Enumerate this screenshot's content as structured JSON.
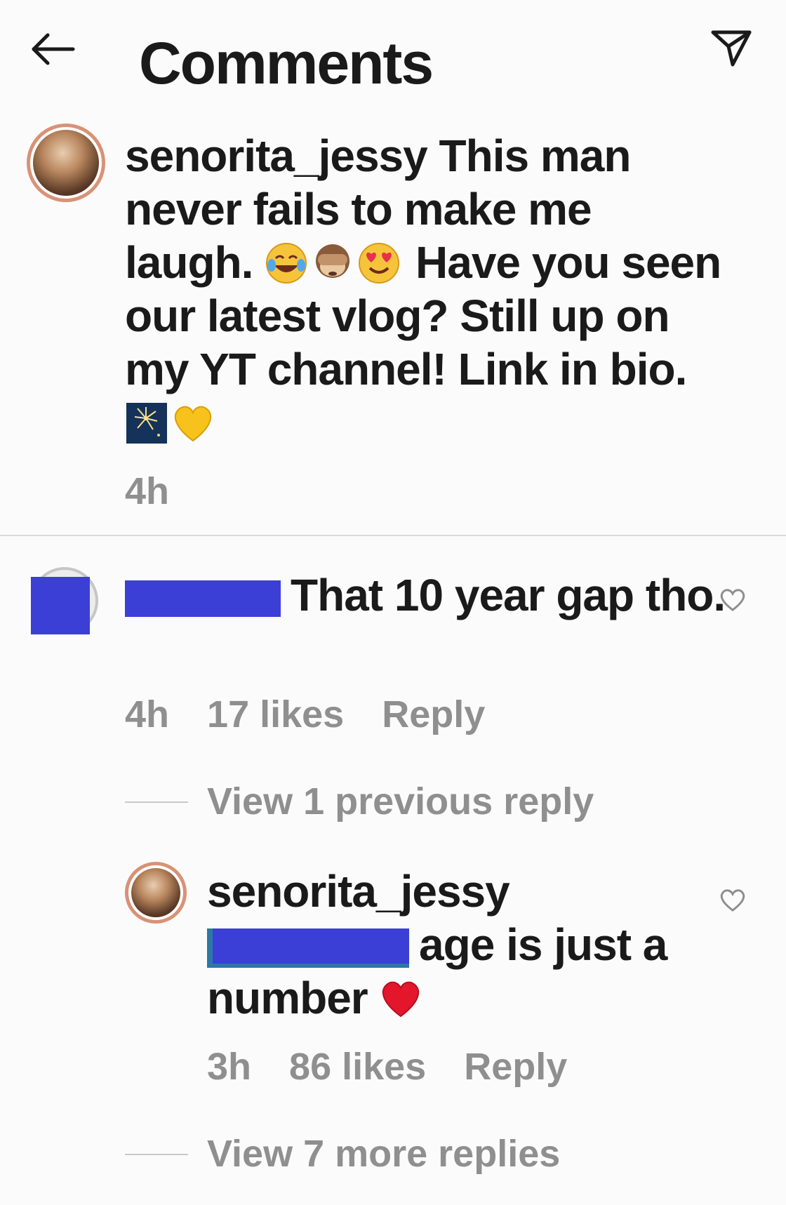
{
  "header": {
    "title": "Comments",
    "back_icon": "arrow-left-icon",
    "share_icon": "paper-plane-icon"
  },
  "caption": {
    "username": "senorita_jessy",
    "text_part1": "This man never fails to make me laugh.",
    "emojis_1": [
      "tears-of-joy",
      "see-no-evil-monkey",
      "heart-eyes"
    ],
    "text_part2": "Have you seen our latest vlog? Still up on my YT channel! Link in bio.",
    "emojis_2": [
      "fireworks",
      "yellow-heart"
    ],
    "time": "4h"
  },
  "comment": {
    "text": "That 10 year gap tho.",
    "time": "4h",
    "likes": "17 likes",
    "reply_label": "Reply",
    "view_replies": "View 1 previous reply"
  },
  "reply": {
    "username": "senorita_jessy",
    "text": "age is just a number",
    "emoji": "red-heart",
    "time": "3h",
    "likes": "86 likes",
    "reply_label": "Reply",
    "view_more": "View 7 more replies"
  },
  "colors": {
    "redaction": "#3b3fd6",
    "meta_gray": "#8f8f8f",
    "text": "#1a1a1a"
  }
}
